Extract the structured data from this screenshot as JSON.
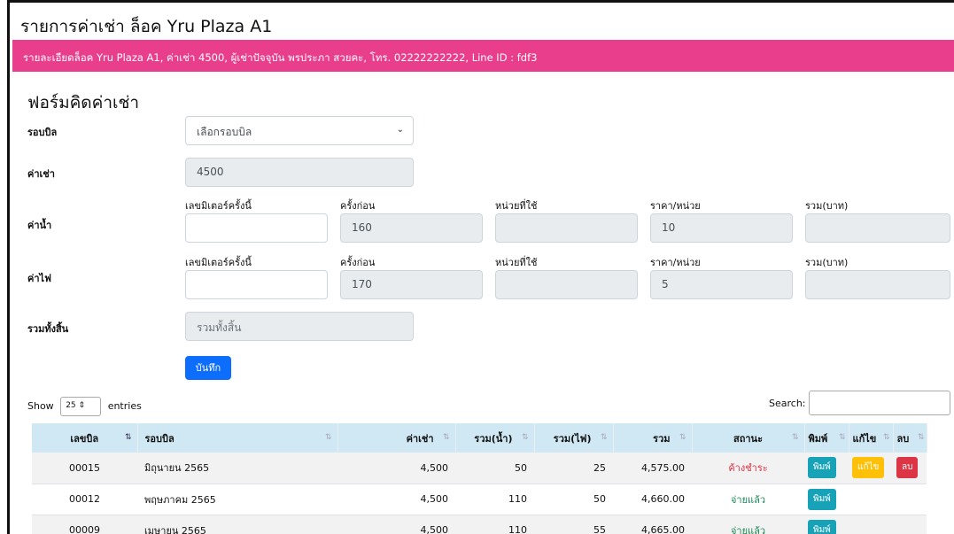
{
  "header": {
    "title": "รายการค่าเช่า ล็อค Yru Plaza A1",
    "alert": "รายละเอียดล็อค Yru Plaza A1, ค่าเช่า 4500, ผู้เช่าปัจจุบัน พรประภา สวยคะ, โทร. 02222222222, Line ID : fdf3"
  },
  "form": {
    "title": "ฟอร์มคิดค่าเช่า",
    "billing_label": "รอบบิล",
    "billing_selected": "เลือกรอบบิล",
    "rent_label": "ค่าเช่า",
    "rent_value": "4500",
    "water_label": "ค่าน้ำ",
    "electric_label": "ค่าไฟ",
    "sub_current": "เลขมิเตอร์ครั้งนี้",
    "sub_previous": "ครั้งก่อน",
    "sub_units": "หน่วยที่ใช้",
    "sub_price": "ราคา/หน่วย",
    "sub_total": "รวม(บาท)",
    "water_previous": "160",
    "water_price": "10",
    "electric_previous": "170",
    "electric_price": "5",
    "grand_total_label": "รวมทั้งสิ้น",
    "grand_total_placeholder": "รวมทั้งสิ้น",
    "save_label": "บันทึก"
  },
  "table_controls": {
    "show_label": "Show",
    "page_length": "25",
    "entries_label": "entries",
    "search_label": "Search:"
  },
  "table": {
    "columns": [
      "เลขบิล",
      "รอบบิล",
      "ค่าเช่า",
      "รวม(น้ำ)",
      "รวม(ไฟ)",
      "รวม",
      "สถานะ",
      "พิมพ์",
      "แก้ไข",
      "ลบ"
    ],
    "rows": [
      {
        "bill": "00015",
        "cycle": "มิถุนายน 2565",
        "rent": "4,500",
        "water": "50",
        "electric": "25",
        "total": "4,575.00",
        "status": "ค้างชำระ",
        "print": "พิมพ์",
        "edit": "แก้ไข",
        "delete": "ลบ"
      },
      {
        "bill": "00012",
        "cycle": "พฤษภาคม 2565",
        "rent": "4,500",
        "water": "110",
        "electric": "50",
        "total": "4,660.00",
        "status": "จ่ายแล้ว",
        "print": "พิมพ์"
      },
      {
        "bill": "00009",
        "cycle": "เมษายน 2565",
        "rent": "4,500",
        "water": "110",
        "electric": "55",
        "total": "4,665.00",
        "status": "จ่ายแล้ว",
        "print": "พิมพ์"
      }
    ]
  },
  "colors": {
    "alert_bg": "#e83e8c",
    "primary": "#0d6efd",
    "table_header_bg": "#cfe8f3",
    "status_due": "#dc3545",
    "status_paid": "#198754",
    "print_btn": "#17a2b8",
    "edit_btn": "#ffc107",
    "delete_btn": "#dc3545"
  },
  "icons": {
    "select_arrow": "chevron-down-icon",
    "sort": "sort-icon",
    "sort_asc": "sort-asc-icon"
  }
}
